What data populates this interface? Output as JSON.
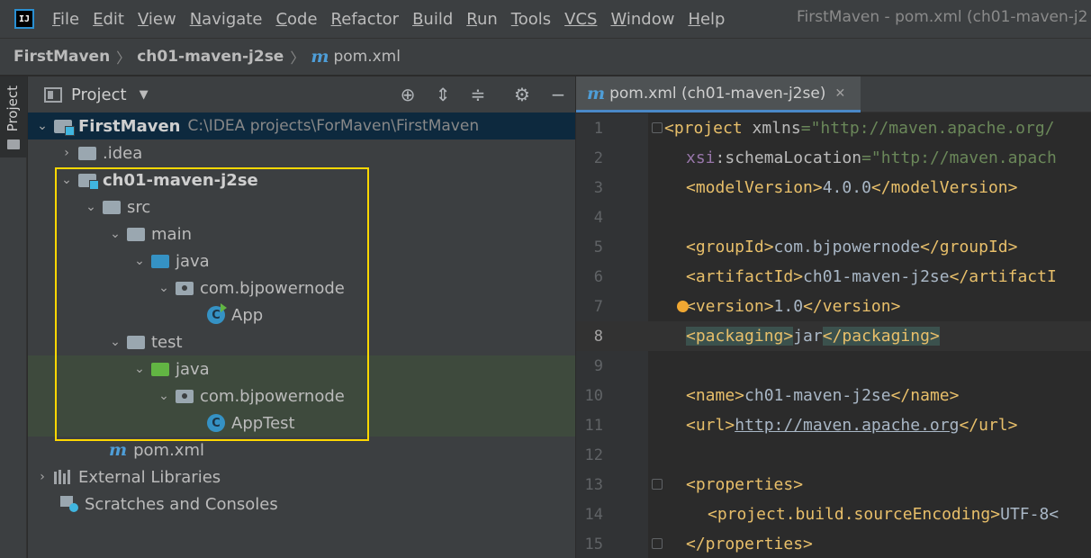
{
  "app": {
    "logo_text": "IJ",
    "window_title": "FirstMaven - pom.xml (ch01-maven-j2"
  },
  "menu": [
    {
      "mn": "F",
      "rest": "ile"
    },
    {
      "mn": "E",
      "rest": "dit"
    },
    {
      "mn": "V",
      "rest": "iew"
    },
    {
      "mn": "N",
      "rest": "avigate"
    },
    {
      "mn": "C",
      "rest": "ode"
    },
    {
      "mn": "R",
      "rest": "efactor"
    },
    {
      "mn": "B",
      "rest": "uild"
    },
    {
      "mn": "R",
      "rest": "un"
    },
    {
      "mn": "T",
      "rest": "ools"
    },
    {
      "mn": "",
      "rest": "VCS"
    },
    {
      "mn": "W",
      "rest": "indow"
    },
    {
      "mn": "H",
      "rest": "elp"
    }
  ],
  "breadcrumb": {
    "project": "FirstMaven",
    "module": "ch01-maven-j2se",
    "file_icon": "m",
    "file": "pom.xml"
  },
  "toolstrip": {
    "project_label": "Project"
  },
  "project_panel": {
    "title": "Project",
    "tree": [
      {
        "label": "FirstMaven",
        "path": "C:\\IDEA projects\\ForMaven\\FirstMaven"
      },
      {
        "label": ".idea"
      },
      {
        "label": "ch01-maven-j2se"
      },
      {
        "label": "src"
      },
      {
        "label": "main"
      },
      {
        "label": "java"
      },
      {
        "label": "com.bjpowernode"
      },
      {
        "label": "App",
        "icon_letter": "C"
      },
      {
        "label": "test"
      },
      {
        "label": "java"
      },
      {
        "label": "com.bjpowernode"
      },
      {
        "label": "AppTest",
        "icon_letter": "C"
      },
      {
        "label": "pom.xml",
        "icon_letter": "m"
      },
      {
        "label": "External Libraries"
      },
      {
        "label": "Scratches and Consoles"
      }
    ]
  },
  "editor": {
    "tab_icon": "m",
    "tab_label": "pom.xml (ch01-maven-j2se)",
    "current_line": 8,
    "lines": [
      {
        "n": "1"
      },
      {
        "n": "2"
      },
      {
        "n": "3"
      },
      {
        "n": "4"
      },
      {
        "n": "5"
      },
      {
        "n": "6"
      },
      {
        "n": "7"
      },
      {
        "n": "8"
      },
      {
        "n": "9"
      },
      {
        "n": "10"
      },
      {
        "n": "11"
      },
      {
        "n": "12"
      },
      {
        "n": "13"
      },
      {
        "n": "14"
      },
      {
        "n": "15"
      }
    ],
    "code": {
      "l1_tag": "<project",
      "l1_attr": " xmlns",
      "l1_eq": "=",
      "l1_val": "\"http://maven.apache.org/",
      "l2_ns": "xsi",
      "l2_attr": ":schemaLocation",
      "l2_eq": "=",
      "l2_val": "\"http://maven.apach",
      "l3_open": "<modelVersion>",
      "l3_text": "4.0.0",
      "l3_close": "</modelVersion>",
      "l5_open": "<groupId>",
      "l5_text": "com.bjpowernode",
      "l5_close": "</groupId>",
      "l6_open": "<artifactId>",
      "l6_text": "ch01-maven-j2se",
      "l6_close": "</artifactI",
      "l7_open": "<version>",
      "l7_text": "1.0",
      "l7_close": "</version>",
      "l8_open": "<packaging>",
      "l8_text": "jar",
      "l8_close": "</packaging>",
      "l10_open": "<name>",
      "l10_text": "ch01-maven-j2se",
      "l10_close": "</name>",
      "l11_open": "<url>",
      "l11_text": "http://maven.apache.org",
      "l11_close": "</url>",
      "l13_open": "<properties>",
      "l14_open": "<project.build.sourceEncoding>",
      "l14_text": "UTF-8<",
      "l15_close": "</properties>"
    }
  }
}
